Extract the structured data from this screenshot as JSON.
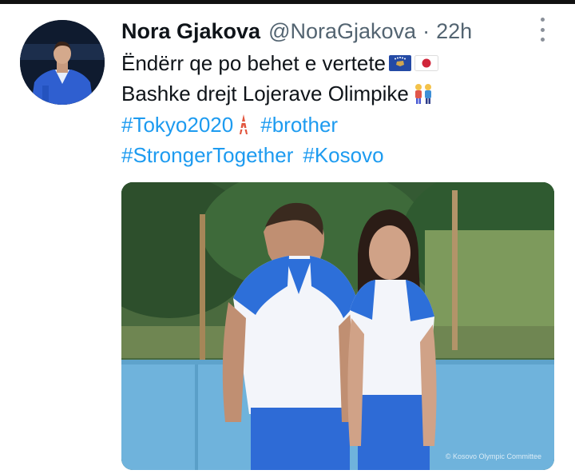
{
  "tweet": {
    "author_name": "Nora Gjakova",
    "author_handle": "@NoraGjakova",
    "separator": "·",
    "time": "22h",
    "line1": "Ëndërr qe po behet e vertete",
    "line2": "Bashke drejt Lojerave Olimpike",
    "hashtags": {
      "tokyo": "#Tokyo2020",
      "brother": "#brother",
      "stronger": "#StrongerTogether",
      "kosovo": "#Kosovo"
    },
    "photo_credit": "© Kosovo Olympic Committee"
  },
  "icons": {
    "more": "more-vertical-icon",
    "flag_kosovo": "kosovo-flag-emoji",
    "flag_japan": "japan-flag-emoji",
    "people": "man-and-woman-emoji",
    "tower": "tokyo-tower-emoji"
  },
  "colors": {
    "link": "#1d9bf0",
    "secondary_text": "#536471",
    "primary_text": "#0f1419"
  }
}
